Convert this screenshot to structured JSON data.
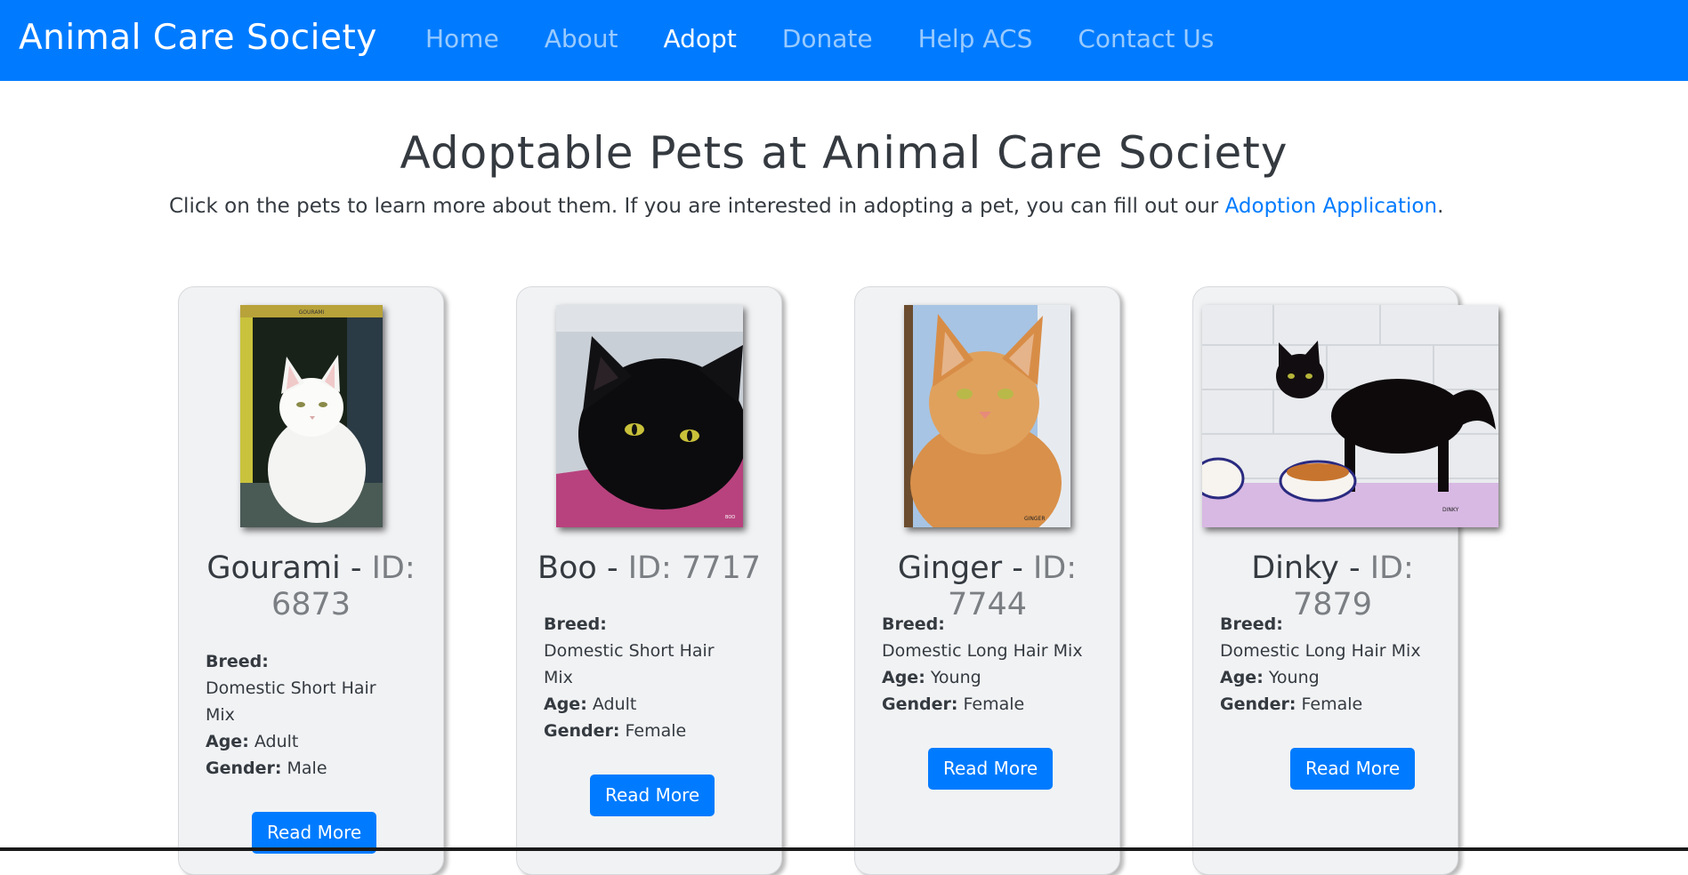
{
  "navbar": {
    "brand": "Animal Care Society",
    "links": [
      "Home",
      "About",
      "Adopt",
      "Donate",
      "Help ACS",
      "Contact Us"
    ],
    "active": "Adopt",
    "color": "#007bff"
  },
  "page": {
    "heading": "Adoptable Pets at Animal Care Society",
    "intro": "Click on the pets to learn more about them. If you are interested in adopting a pet, you can fill out our ",
    "intro_link": "Adoption Application",
    "intro_end": "."
  },
  "labels": {
    "breed": "Breed:",
    "age": "Age:",
    "gender": "Gender:",
    "read_more": "Read More",
    "id_sep": " - ",
    "id_prefix": "ID: "
  },
  "pets": [
    {
      "name": "Gourami",
      "id": "6873",
      "breed": "Domestic Short Hair Mix",
      "age": "Adult",
      "gender": "Male",
      "photo_caption": "GOURAMI"
    },
    {
      "name": "Boo",
      "id": "7717",
      "breed": "Domestic Short Hair Mix",
      "age": "Adult",
      "gender": "Female",
      "photo_caption": "BOO"
    },
    {
      "name": "Ginger",
      "id": "7744",
      "breed": "Domestic Long Hair Mix",
      "age": "Young",
      "gender": "Female",
      "photo_caption": "GINGER"
    },
    {
      "name": "Dinky",
      "id": "7879",
      "breed": "Domestic Long Hair Mix",
      "age": "Young",
      "gender": "Female",
      "photo_caption": "DINKY"
    }
  ]
}
